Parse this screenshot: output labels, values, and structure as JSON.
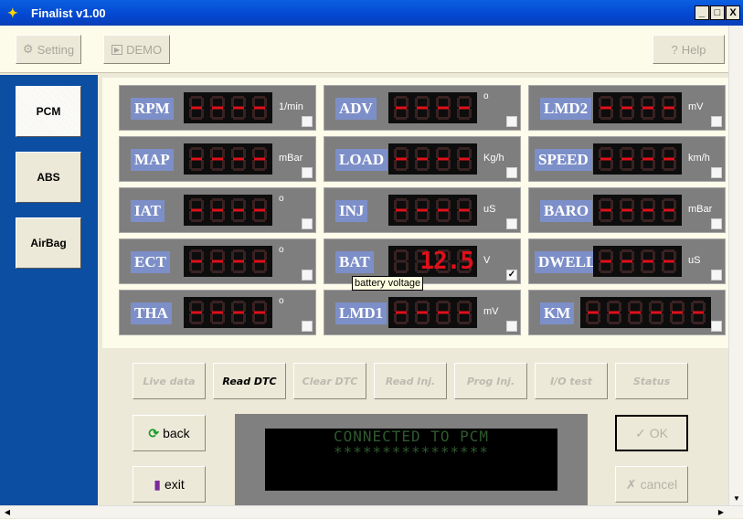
{
  "window": {
    "title": "Finalist v1.00",
    "minimize": "_",
    "maximize": "□",
    "close": "X"
  },
  "toolbar": {
    "setting": "Setting",
    "demo": "DEMO",
    "help": "Help"
  },
  "sidebar": [
    {
      "label": "PCM",
      "active": true
    },
    {
      "label": "ABS",
      "active": false
    },
    {
      "label": "AirBag",
      "active": false
    }
  ],
  "gauges": [
    {
      "label": "RPM",
      "unit": "1/min",
      "digits": [
        "-",
        "-",
        "-",
        "-"
      ],
      "checked": false
    },
    {
      "label": "ADV",
      "unit": "o",
      "digits": [
        "-",
        "-",
        "-",
        "-"
      ],
      "checked": false
    },
    {
      "label": "LMD2",
      "unit": "mV",
      "digits": [
        "-",
        "-",
        "-",
        "-"
      ],
      "checked": false
    },
    {
      "label": "MAP",
      "unit": "mBar",
      "digits": [
        "-",
        "-",
        "-",
        "-"
      ],
      "checked": false
    },
    {
      "label": "LOAD",
      "unit": "Kg/h",
      "digits": [
        "-",
        "-",
        "-",
        "-"
      ],
      "checked": false
    },
    {
      "label": "SPEED",
      "unit": "km/h",
      "digits": [
        "-",
        "-",
        "-",
        "-"
      ],
      "checked": false
    },
    {
      "label": "IAT",
      "unit": "o",
      "digits": [
        "-",
        "-",
        "-",
        "-"
      ],
      "checked": false
    },
    {
      "label": "INJ",
      "unit": "uS",
      "digits": [
        "-",
        "-",
        "-",
        "-"
      ],
      "checked": false
    },
    {
      "label": "BARO",
      "unit": "mBar",
      "digits": [
        "-",
        "-",
        "-",
        "-"
      ],
      "checked": false
    },
    {
      "label": "ECT",
      "unit": "o",
      "digits": [
        "-",
        "-",
        "-",
        "-"
      ],
      "checked": false
    },
    {
      "label": "BAT",
      "unit": "V",
      "digits": [
        " ",
        "1",
        "2.",
        "5"
      ],
      "value": "12.5",
      "checked": true
    },
    {
      "label": "DWELL",
      "unit": "uS",
      "digits": [
        "-",
        "-",
        "-",
        "-"
      ],
      "checked": false
    },
    {
      "label": "THA",
      "unit": "o",
      "digits": [
        "-",
        "-",
        "-",
        "-"
      ],
      "checked": false
    },
    {
      "label": "LMD1",
      "unit": "mV",
      "digits": [
        "-",
        "-",
        "-",
        "-"
      ],
      "checked": false
    },
    {
      "label": "KM",
      "unit": "",
      "digits": [
        "-",
        "-",
        "-",
        "-",
        "-",
        "-"
      ],
      "checked": false
    }
  ],
  "tooltip": "battery voltage",
  "functions": [
    {
      "label": "Live data",
      "enabled": false
    },
    {
      "label": "Read DTC",
      "enabled": true
    },
    {
      "label": "Clear DTC",
      "enabled": false
    },
    {
      "label": "Read Inj.",
      "enabled": false
    },
    {
      "label": "Prog Inj.",
      "enabled": false
    },
    {
      "label": "I/O test",
      "enabled": false
    },
    {
      "label": "Status",
      "enabled": false
    }
  ],
  "actions": {
    "back": "back",
    "exit": "exit",
    "ok": "OK",
    "cancel": "cancel"
  },
  "lcd": {
    "line1": "CONNECTED TO PCM",
    "line2": "****************"
  },
  "colors": {
    "segment_on": "#e0101a",
    "segment_off": "#3a2222",
    "label_bg": "#7d8fc8",
    "title_bar": "#0347d0"
  }
}
